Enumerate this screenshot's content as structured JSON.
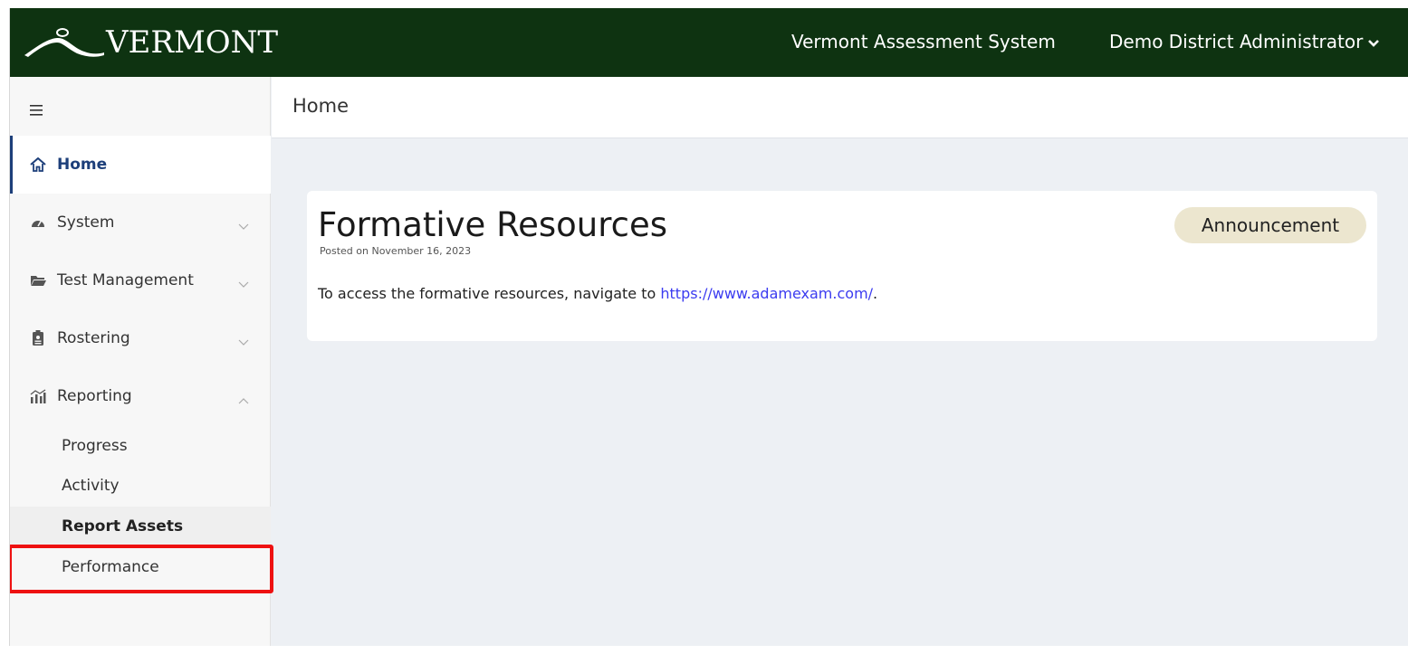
{
  "header": {
    "logo_text": "VERMONT",
    "system_title": "Vermont Assessment System",
    "user_name": "Demo District Administrator"
  },
  "sidebar": {
    "menu_icon": "hamburger-icon",
    "items": [
      {
        "label": "Home",
        "icon": "home-icon"
      },
      {
        "label": "System",
        "icon": "gauge-icon"
      },
      {
        "label": "Test Management",
        "icon": "folder-icon"
      },
      {
        "label": "Rostering",
        "icon": "id-badge-icon"
      },
      {
        "label": "Reporting",
        "icon": "chart-icon"
      }
    ],
    "reporting_subitems": [
      "Progress",
      "Activity",
      "Report Assets",
      "Performance"
    ]
  },
  "breadcrumb": "Home",
  "announcement": {
    "title": "Formative Resources",
    "posted": "Posted on November 16, 2023",
    "body_prefix": "To access the formative resources, navigate to ",
    "link_text": "https://www.adamexam.com/",
    "body_suffix": ".",
    "badge": "Announcement"
  },
  "colors": {
    "header_bg": "#0e3311",
    "nav_active": "#1d3f7a",
    "link": "#3b3bf0",
    "badge_bg": "#ece6cf",
    "highlight": "#ee1111"
  }
}
